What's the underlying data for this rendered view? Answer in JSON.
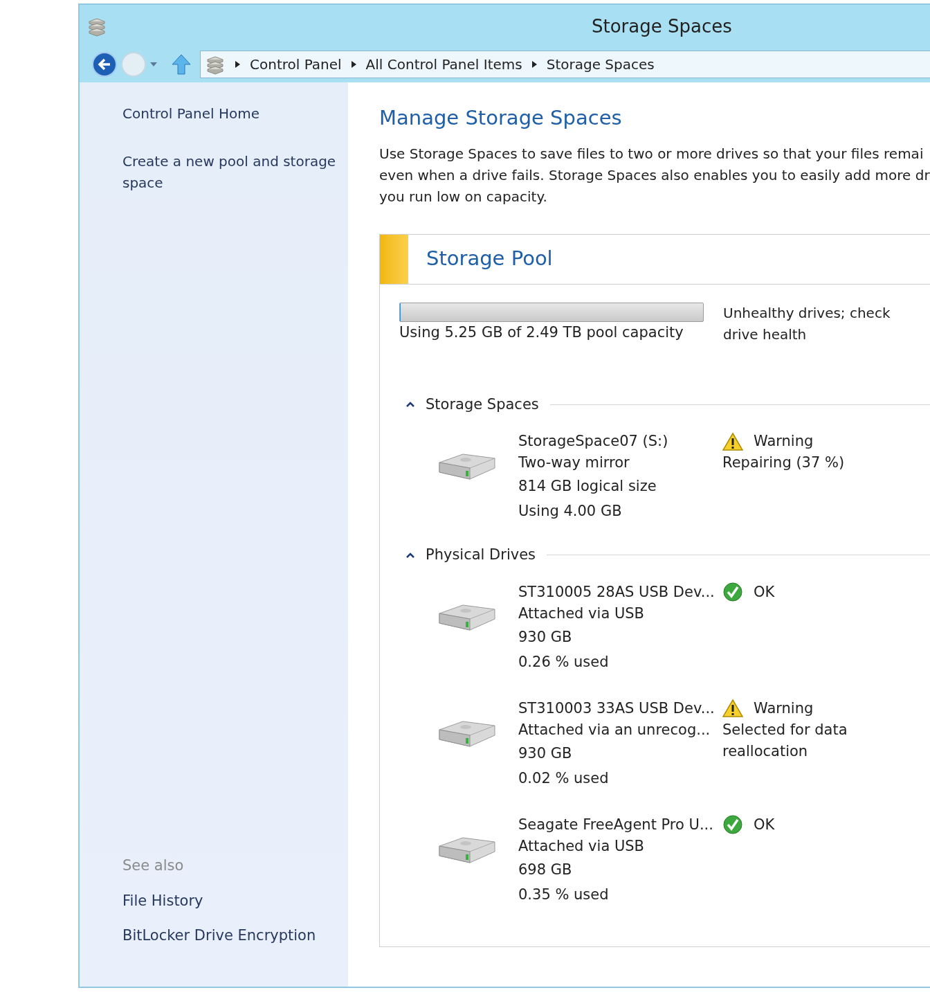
{
  "window": {
    "title": "Storage Spaces"
  },
  "address_bar": {
    "crumbs": [
      "Control Panel",
      "All Control Panel Items",
      "Storage Spaces"
    ]
  },
  "sidebar": {
    "links": [
      "Control Panel Home",
      "Create a new pool and storage space"
    ],
    "see_also": {
      "heading": "See also",
      "links": [
        "File History",
        "BitLocker Drive Encryption"
      ]
    }
  },
  "content": {
    "heading": "Manage Storage Spaces",
    "description_lines": [
      "Use Storage Spaces to save files to two or more drives so that your files remai",
      "even when a drive fails. Storage Spaces also enables you to easily add more dr",
      "you run low on capacity."
    ],
    "pool": {
      "title": "Storage Pool",
      "capacity": {
        "level": 0.002,
        "caption": "Using 5.25 GB of 2.49 TB pool capacity"
      },
      "status": "Unhealthy drives; check drive health",
      "sections": [
        {
          "title": "Storage Spaces",
          "expanded": true,
          "items": [
            {
              "lines": [
                "StorageSpace07 (S:)",
                "Two-way mirror",
                "814 GB logical size",
                "Using 4.00 GB"
              ],
              "status": {
                "kind": "warning",
                "label": "Warning",
                "detail": "Repairing (37 %)"
              }
            }
          ]
        },
        {
          "title": "Physical Drives",
          "expanded": true,
          "items": [
            {
              "lines": [
                "ST310005 28AS USB Dev...",
                "Attached via USB",
                "930 GB",
                "0.26 % used"
              ],
              "status": {
                "kind": "ok",
                "label": "OK"
              }
            },
            {
              "lines": [
                "ST310003 33AS USB Dev...",
                "Attached via an unrecog...",
                "930 GB",
                "0.02 % used"
              ],
              "status": {
                "kind": "warning",
                "label": "Warning",
                "detail": "Selected for data reallocation"
              }
            },
            {
              "lines": [
                "Seagate FreeAgent Pro U...",
                "Attached via USB",
                "698 GB",
                "0.35 % used"
              ],
              "status": {
                "kind": "ok",
                "label": "OK"
              }
            }
          ]
        }
      ]
    }
  }
}
